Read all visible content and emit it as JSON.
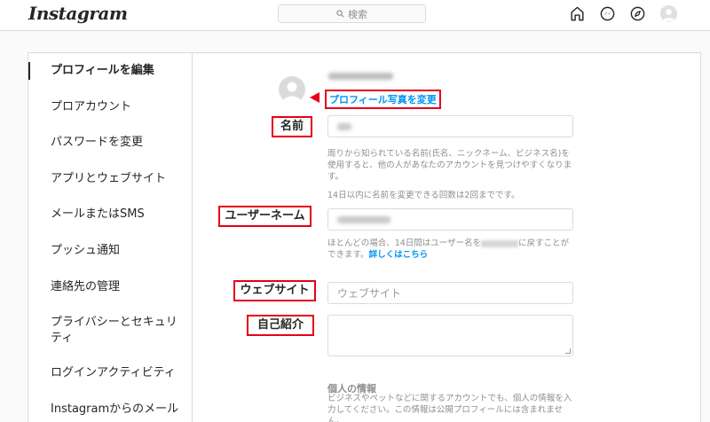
{
  "header": {
    "logo": "Instagram",
    "search_placeholder": "検索",
    "nav_icons": [
      "home-icon",
      "messenger-icon",
      "explore-icon",
      "heart-icon",
      "profile-avatar"
    ]
  },
  "sidebar": {
    "items": [
      {
        "label": "プロフィールを編集",
        "active": true
      },
      {
        "label": "プロアカウント"
      },
      {
        "label": "パスワードを変更"
      },
      {
        "label": "アプリとウェブサイト"
      },
      {
        "label": "メールまたはSMS"
      },
      {
        "label": "プッシュ通知"
      },
      {
        "label": "連絡先の管理"
      },
      {
        "label": "プライバシーとセキュリ"
      },
      {
        "label": "ティ"
      },
      {
        "label": "ログインアクティビティ"
      },
      {
        "label": "Instagramからのメール"
      }
    ]
  },
  "form": {
    "change_photo": "プロフィール写真を変更",
    "name": {
      "label": "名前",
      "help1": "周りから知られている名前(氏名、ニックネーム、ビジネス名)を",
      "help2": "使用すると、他の人があなたのアカウントを見つけやすくなりま",
      "help3": "す。",
      "help4": "14日以内に名前を変更できる回数は2回までです。"
    },
    "username": {
      "label": "ユーザーネーム",
      "help1_pre": "ほとんどの場合、14日間はユーザー名を",
      "help1_post": "に戻すことが",
      "help2": "できます。",
      "learn_more": "詳しくはこちら"
    },
    "website": {
      "label": "ウェブサイト",
      "placeholder": "ウェブサイト"
    },
    "bio": {
      "label": "自己紹介"
    },
    "personal_info": {
      "title": "個人の情報",
      "help1": "ビジネスやペットなどに関するアカウントでも、個人の情報を入",
      "help2": "力してください。この情報は公開プロフィールには含まれませ",
      "help3": "ん。"
    }
  },
  "colors": {
    "accent": "#0095f6",
    "annotation": "#e6001a"
  }
}
